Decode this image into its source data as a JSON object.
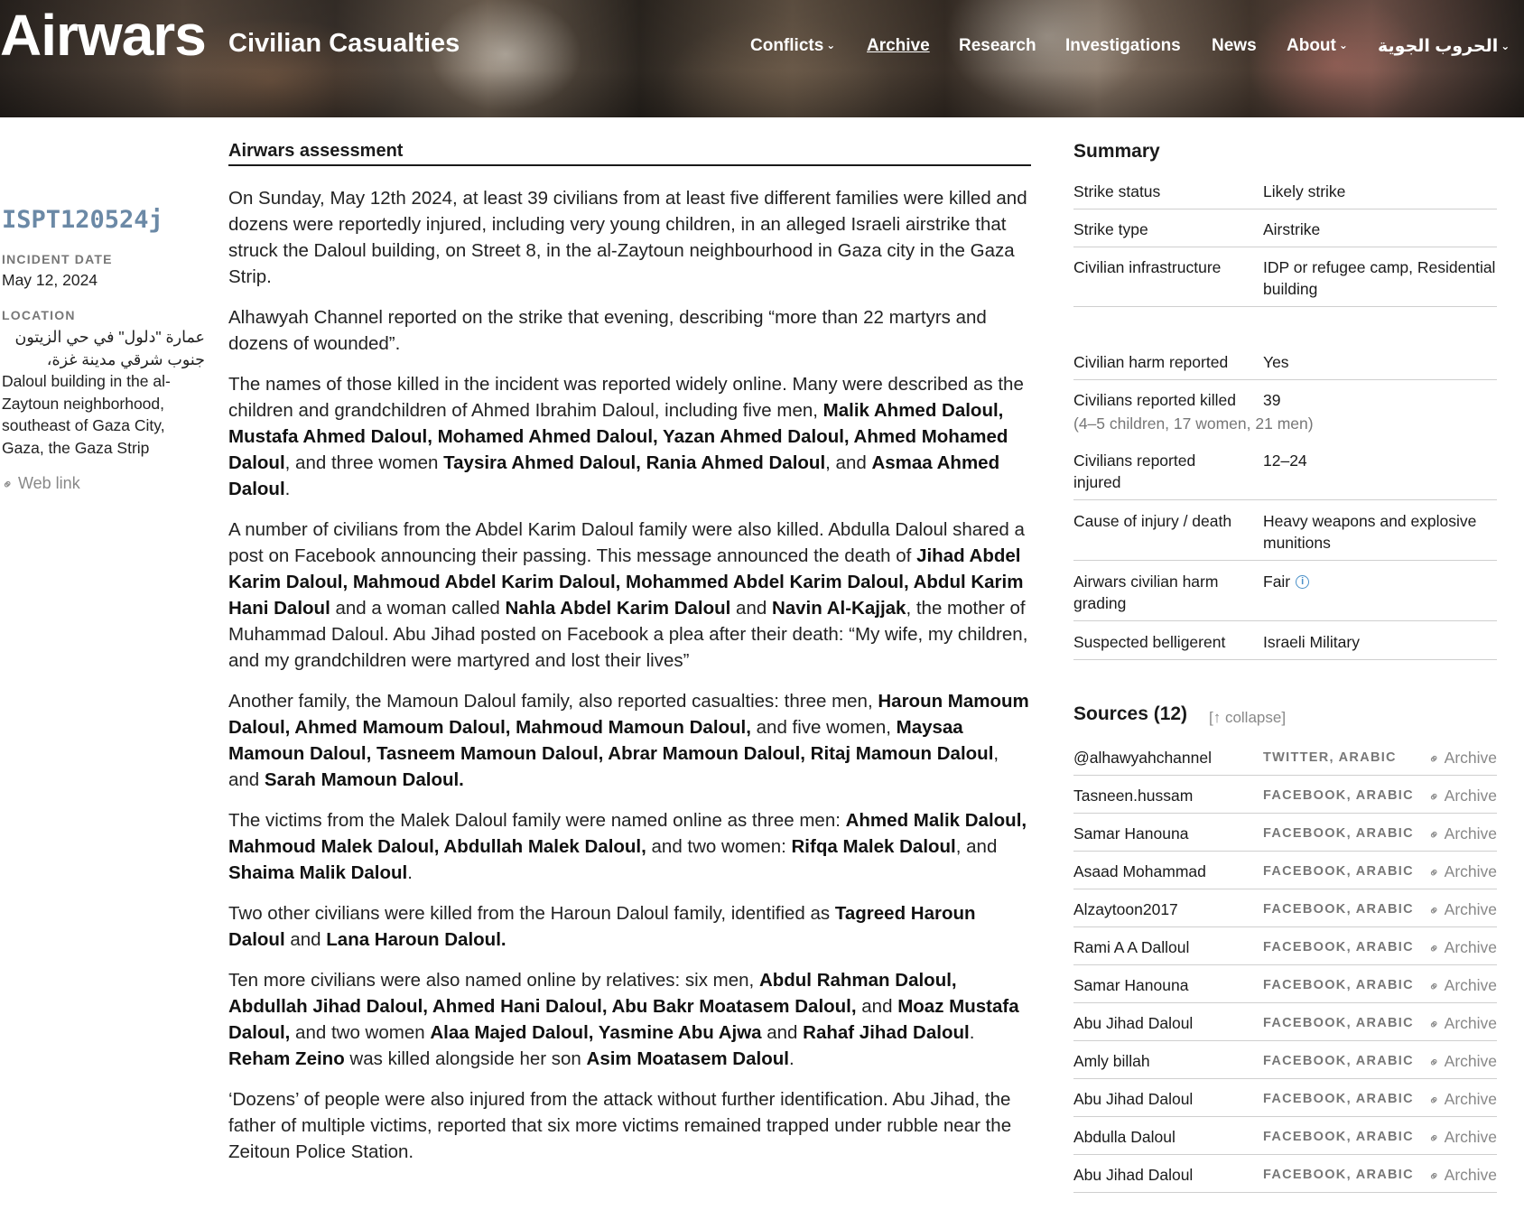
{
  "header": {
    "logo": "Airwars",
    "subtitle": "Civilian Casualties",
    "nav": [
      {
        "label": "Conflicts",
        "dropdown": true
      },
      {
        "label": "Archive",
        "dropdown": false,
        "active": true
      },
      {
        "label": "Research",
        "dropdown": false
      },
      {
        "label": "Investigations",
        "dropdown": false
      },
      {
        "label": "News",
        "dropdown": false
      },
      {
        "label": "About",
        "dropdown": true
      },
      {
        "label": "الحروب الجوية",
        "dropdown": true
      }
    ]
  },
  "incident": {
    "id": "ISPT120524j",
    "date_label": "INCIDENT DATE",
    "date": "May 12, 2024",
    "location_label": "LOCATION",
    "location_lines": [
      "عمارة \"دلول\" في حي الزيتون",
      "جنوب شرقي مدينة غزة،",
      "Daloul building in the al-",
      "Zaytoun neighborhood,",
      "southeast of Gaza City,",
      "Gaza, the Gaza Strip"
    ],
    "web_link": "Web link"
  },
  "assessment": {
    "title": "Airwars assessment",
    "paragraphs": [
      [
        {
          "t": "On Sunday, May 12th 2024, at least 39 civilians from at least five different families were killed and dozens were reportedly injured, including very young children, in an alleged Israeli airstrike that struck the Daloul building, on Street 8, in the al-Zaytoun neighbourhood in Gaza city in the Gaza Strip."
        }
      ],
      [
        {
          "t": "Alhawyah Channel reported on the strike that evening, describing “more than 22 martyrs and dozens of wounded”."
        }
      ],
      [
        {
          "t": "The names of those killed in the incident was reported widely online. Many were described as the children and grandchildren of Ahmed Ibrahim Daloul, including five men, "
        },
        {
          "t": "Malik Ahmed Daloul, Mustafa Ahmed Daloul, Mohamed Ahmed Daloul, Yazan Ahmed Daloul, Ahmed Mohamed Daloul",
          "b": true
        },
        {
          "t": ", and three women "
        },
        {
          "t": "Taysira Ahmed Daloul, Rania Ahmed Daloul",
          "b": true
        },
        {
          "t": ", and "
        },
        {
          "t": "Asmaa Ahmed Daloul",
          "b": true
        },
        {
          "t": "."
        }
      ],
      [
        {
          "t": "A number of civilians from the Abdel Karim Daloul family were also killed. Abdulla Daloul shared a post on Facebook announcing their passing. This message announced the death of "
        },
        {
          "t": "Jihad Abdel Karim Daloul, Mahmoud Abdel Karim Daloul, Mohammed Abdel Karim Daloul,  Abdul Karim Hani Daloul",
          "b": true
        },
        {
          "t": " and a woman called "
        },
        {
          "t": "Nahla Abdel Karim Daloul",
          "b": true
        },
        {
          "t": " and "
        },
        {
          "t": "Navin Al-Kajjak",
          "b": true
        },
        {
          "t": ", the mother of Muhammad Daloul. Abu Jihad posted on Facebook a plea after their death: “My wife, my children, and my grandchildren were martyred and lost their lives”"
        }
      ],
      [
        {
          "t": "Another family, the Mamoun Daloul family, also reported casualties: three men, "
        },
        {
          "t": "Haroun Mamoum Daloul, Ahmed Mamoum Daloul, Mahmoud Mamoun Daloul,",
          "b": true
        },
        {
          "t": " and five women, "
        },
        {
          "t": "Maysaa Mamoun Daloul, Tasneem Mamoun Daloul, Abrar Mamoun Daloul, Ritaj Mamoun Daloul",
          "b": true
        },
        {
          "t": ", and "
        },
        {
          "t": "Sarah Mamoun Daloul.",
          "b": true
        }
      ],
      [
        {
          "t": "The victims from the Malek Daloul family were named online as three men: "
        },
        {
          "t": "Ahmed Malik Daloul, Mahmoud Malek Daloul, Abdullah Malek Daloul,",
          "b": true
        },
        {
          "t": " and two women: "
        },
        {
          "t": "Rifqa Malek Daloul",
          "b": true
        },
        {
          "t": ", and "
        },
        {
          "t": "Shaima Malik Daloul",
          "b": true
        },
        {
          "t": "."
        }
      ],
      [
        {
          "t": "Two other civilians were killed from the Haroun Daloul family, identified as "
        },
        {
          "t": "Tagreed Haroun Daloul",
          "b": true
        },
        {
          "t": " and "
        },
        {
          "t": "Lana Haroun Daloul.",
          "b": true
        }
      ],
      [
        {
          "t": "Ten more civilians were also named online by relatives: six men, "
        },
        {
          "t": "Abdul Rahman Daloul, Abdullah Jihad Daloul, Ahmed Hani Daloul,  Abu Bakr Moatasem Daloul,",
          "b": true
        },
        {
          "t": " and "
        },
        {
          "t": "Moaz Mustafa Daloul,",
          "b": true
        },
        {
          "t": " and two women "
        },
        {
          "t": "Alaa Majed Daloul, Yasmine Abu Ajwa",
          "b": true
        },
        {
          "t": " and "
        },
        {
          "t": "Rahaf Jihad Daloul",
          "b": true
        },
        {
          "t": ". "
        },
        {
          "t": "Reham Zeino",
          "b": true
        },
        {
          "t": " was killed alongside her son "
        },
        {
          "t": "Asim Moatasem Daloul",
          "b": true
        },
        {
          "t": "."
        }
      ],
      [
        {
          "t": "‘Dozens’ of people were also injured from the attack without further identification. Abu Jihad, the father of multiple victims, reported that six more victims remained trapped under rubble near the Zeitoun Police Station."
        }
      ]
    ]
  },
  "summary": {
    "title": "Summary",
    "rows": [
      {
        "label": "Strike status",
        "value": "Likely strike"
      },
      {
        "label": "Strike type",
        "value": "Airstrike"
      },
      {
        "label": "Civilian infrastructure",
        "value": "IDP or refugee camp, Residential building"
      },
      {
        "label": "Civilian harm reported",
        "value": "Yes"
      },
      {
        "label": "Civilians reported killed",
        "value": "39",
        "sub": "(4–5 children, 17 women, 21 men)"
      },
      {
        "label": "Civilians reported injured",
        "value": "12–24"
      },
      {
        "label": "Cause of injury / death",
        "value": "Heavy weapons and explosive munitions"
      },
      {
        "label": "Airwars civilian harm grading",
        "value": "Fair",
        "info": true
      },
      {
        "label": "Suspected belligerent",
        "value": "Israeli Military"
      }
    ]
  },
  "sources": {
    "title": "Sources (12)",
    "collapse_label": "[↑ collapse]",
    "archive_label": "Archive",
    "items": [
      {
        "name": "@alhawyahchannel",
        "tag": "TWITTER, ARABIC"
      },
      {
        "name": "Tasneen.hussam",
        "tag": "FACEBOOK, ARABIC"
      },
      {
        "name": "Samar Hanouna",
        "tag": "FACEBOOK, ARABIC"
      },
      {
        "name": "Asaad Mohammad",
        "tag": "FACEBOOK, ARABIC"
      },
      {
        "name": "Alzaytoon2017",
        "tag": "FACEBOOK, ARABIC"
      },
      {
        "name": "Rami A A Dalloul",
        "tag": "FACEBOOK, ARABIC"
      },
      {
        "name": "Samar Hanouna",
        "tag": "FACEBOOK, ARABIC"
      },
      {
        "name": "Abu Jihad Daloul",
        "tag": "FACEBOOK, ARABIC"
      },
      {
        "name": "Amly billah",
        "tag": "FACEBOOK, ARABIC"
      },
      {
        "name": "Abu Jihad Daloul",
        "tag": "FACEBOOK, ARABIC"
      },
      {
        "name": "Abdulla Daloul",
        "tag": "FACEBOOK, ARABIC"
      },
      {
        "name": "Abu Jihad Daloul",
        "tag": "FACEBOOK, ARABIC"
      }
    ]
  },
  "colors": {
    "accent_id": "#6b89a6",
    "muted": "#777777",
    "info": "#4a90c8",
    "divider": "#cfcfcf"
  }
}
